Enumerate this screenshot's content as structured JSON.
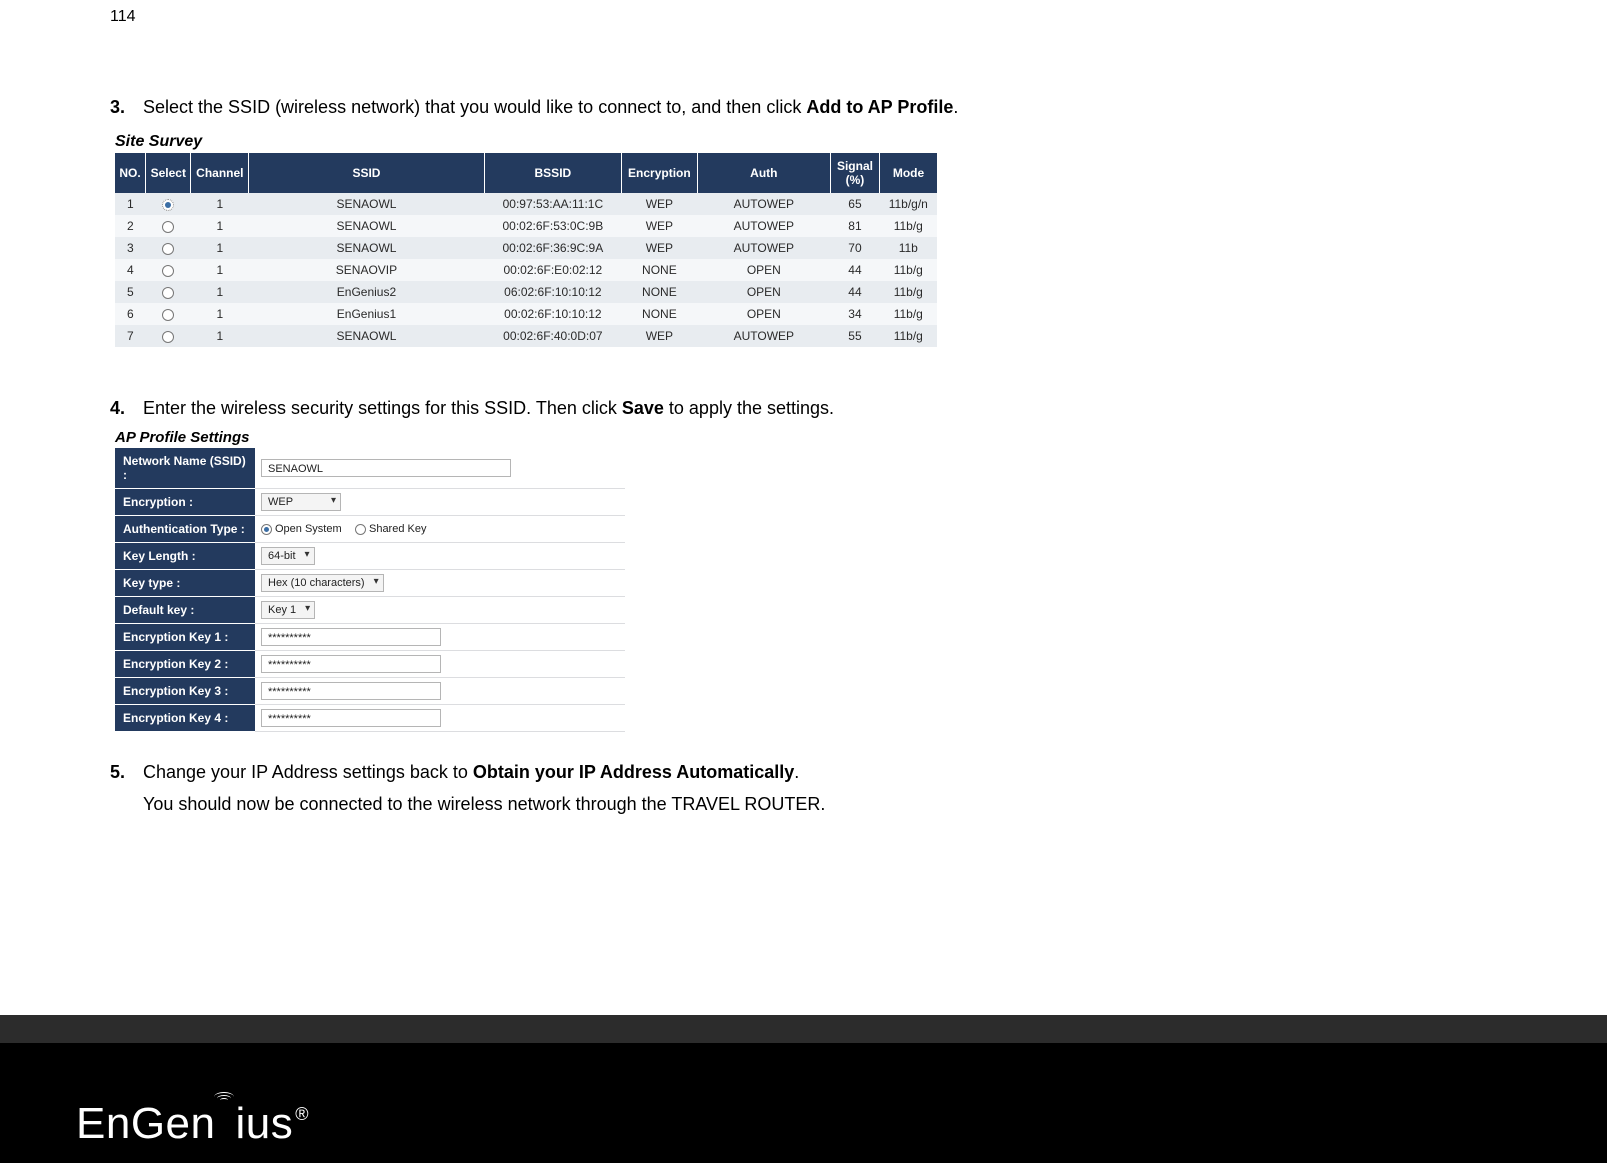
{
  "page_number": "114",
  "steps": {
    "s3": {
      "num": "3.",
      "text_before": "Select the SSID (wireless network) that you would like to connect to, and then click ",
      "bold": "Add to AP Profile",
      "text_after": "."
    },
    "s4": {
      "num": "4.",
      "text_before": "Enter the wireless security settings for this SSID.  Then click ",
      "bold": "Save",
      "text_after": " to apply the settings."
    },
    "s5": {
      "num": "5.",
      "text_before": "Change your IP Address settings back to ",
      "bold": "Obtain your IP Address Automatically",
      "text_after": ".",
      "sub": "You should now be connected to the wireless network through the TRAVEL ROUTER."
    }
  },
  "survey": {
    "title": "Site Survey",
    "headers": [
      "NO.",
      "Select",
      "Channel",
      "SSID",
      "BSSID",
      "Encryption",
      "Auth",
      "Signal (%)",
      "Mode"
    ],
    "rows": [
      {
        "no": "1",
        "selected": true,
        "channel": "1",
        "ssid": "SENAOWL",
        "bssid": "00:97:53:AA:11:1C",
        "enc": "WEP",
        "auth": "AUTOWEP",
        "signal": "65",
        "mode": "11b/g/n"
      },
      {
        "no": "2",
        "selected": false,
        "channel": "1",
        "ssid": "SENAOWL",
        "bssid": "00:02:6F:53:0C:9B",
        "enc": "WEP",
        "auth": "AUTOWEP",
        "signal": "81",
        "mode": "11b/g"
      },
      {
        "no": "3",
        "selected": false,
        "channel": "1",
        "ssid": "SENAOWL",
        "bssid": "00:02:6F:36:9C:9A",
        "enc": "WEP",
        "auth": "AUTOWEP",
        "signal": "70",
        "mode": "11b"
      },
      {
        "no": "4",
        "selected": false,
        "channel": "1",
        "ssid": "SENAOVIP",
        "bssid": "00:02:6F:E0:02:12",
        "enc": "NONE",
        "auth": "OPEN",
        "signal": "44",
        "mode": "11b/g"
      },
      {
        "no": "5",
        "selected": false,
        "channel": "1",
        "ssid": "EnGenius2",
        "bssid": "06:02:6F:10:10:12",
        "enc": "NONE",
        "auth": "OPEN",
        "signal": "44",
        "mode": "11b/g"
      },
      {
        "no": "6",
        "selected": false,
        "channel": "1",
        "ssid": "EnGenius1",
        "bssid": "00:02:6F:10:10:12",
        "enc": "NONE",
        "auth": "OPEN",
        "signal": "34",
        "mode": "11b/g"
      },
      {
        "no": "7",
        "selected": false,
        "channel": "1",
        "ssid": "SENAOWL",
        "bssid": "00:02:6F:40:0D:07",
        "enc": "WEP",
        "auth": "AUTOWEP",
        "signal": "55",
        "mode": "11b/g"
      }
    ]
  },
  "profile": {
    "title": "AP Profile Settings",
    "fields": {
      "ssid_label": "Network Name (SSID) :",
      "ssid_value": "SENAOWL",
      "encryption_label": "Encryption :",
      "encryption_value": "WEP",
      "auth_label": "Authentication Type :",
      "auth_open": "Open System",
      "auth_shared": "Shared Key",
      "keylen_label": "Key Length :",
      "keylen_value": "64-bit",
      "keytype_label": "Key type :",
      "keytype_value": "Hex (10 characters)",
      "default_label": "Default key :",
      "default_value": "Key 1",
      "k1_label": "Encryption Key 1 :",
      "k2_label": "Encryption Key 2 :",
      "k3_label": "Encryption Key 3 :",
      "k4_label": "Encryption Key 4 :",
      "key_mask": "**********"
    }
  },
  "logo": {
    "part1": "EnGen",
    "part2": "us",
    "reg": "®"
  }
}
